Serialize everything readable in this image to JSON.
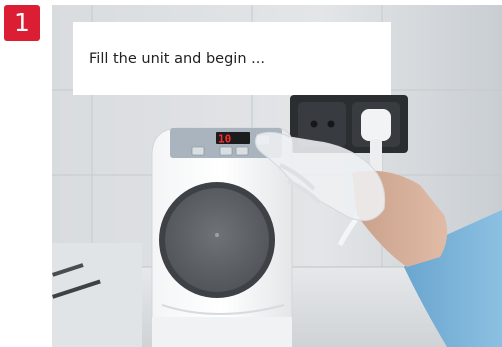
{
  "step": {
    "number": "1",
    "color": "#dc1e35"
  },
  "caption": {
    "text": "Fill the unit and begin ..."
  },
  "photo": {
    "display_digits": "10"
  }
}
